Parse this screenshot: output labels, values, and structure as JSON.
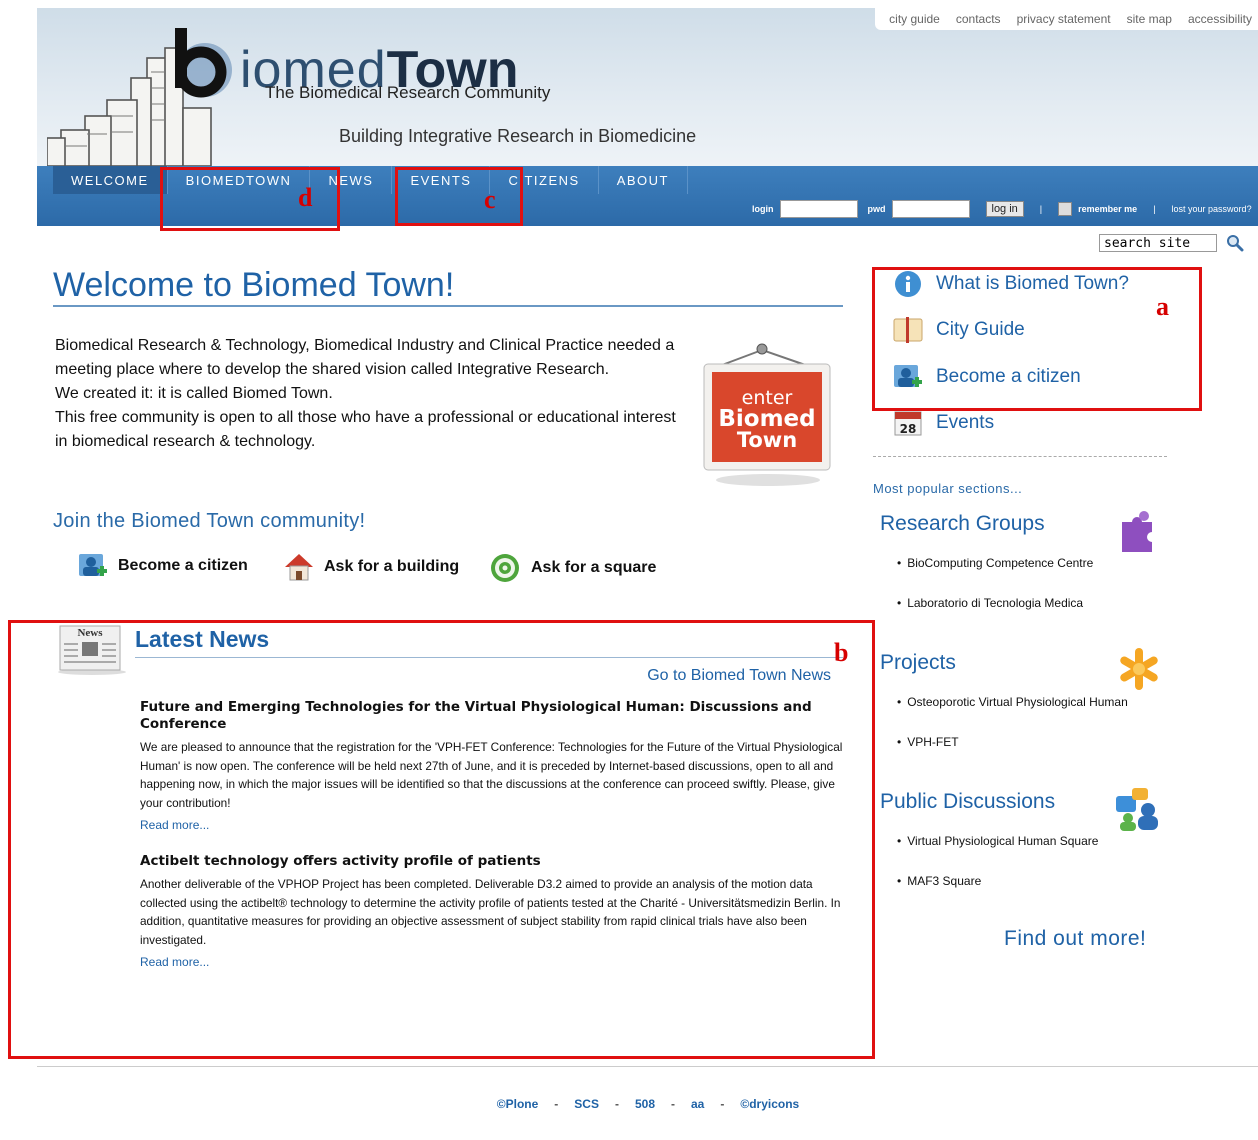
{
  "header": {
    "top_links": [
      "city guide",
      "contacts",
      "privacy statement",
      "site map",
      "accessibility"
    ],
    "logo_light": "iomed",
    "logo_bold": "Town",
    "tagline": "The Biomedical Research Community",
    "subtagline": "Building Integrative Research in Biomedicine"
  },
  "nav": {
    "tabs": [
      "WELCOME",
      "BIOMEDTOWN",
      "NEWS",
      "EVENTS",
      "CITIZENS",
      "ABOUT"
    ],
    "active_tab": "WELCOME"
  },
  "login": {
    "login_label": "login",
    "pwd_label": "pwd",
    "button": "log in",
    "remember": "remember me",
    "lost": "lost your password?"
  },
  "search": {
    "value": "search site"
  },
  "main": {
    "title": "Welcome to Biomed Town!",
    "intro": [
      "Biomedical Research & Technology, Biomedical Industry and Clinical Practice needed a meeting place where to develop the shared vision called Integrative Research.",
      "We created it: it is called Biomed Town.",
      "This free community is open to all those who have a professional or educational interest in biomedical research & technology."
    ],
    "sign": {
      "line1": "enter",
      "line2": "Biomed",
      "line3": "Town"
    },
    "join_title": "Join the Biomed Town community!",
    "join_items": [
      "Become a citizen",
      "Ask for a building",
      "Ask for a square"
    ]
  },
  "news": {
    "icon_label": "News",
    "title": "Latest News",
    "go_link": "Go to Biomed Town News",
    "articles": [
      {
        "title": "Future and Emerging Technologies for the Virtual Physiological Human: Discussions and Conference",
        "body": "We are pleased to announce that the registration for the 'VPH-FET Conference: Technologies for the Future of the Virtual Physiological Human' is now open. The conference will be held next 27th of June, and it is preceded by Internet-based discussions, open to all and happening now, in which the major issues will be identified so that the discussions at the conference can proceed swiftly. Please, give your contribution!",
        "more": "Read more..."
      },
      {
        "title": "Actibelt technology offers activity profile of patients",
        "body": "Another deliverable of the VPHOP Project has been completed. Deliverable D3.2 aimed to provide an analysis of the motion data collected using the actibelt® technology to determine the activity profile of patients tested at the Charité - Universitätsmedizin Berlin. In addition, quantitative measures for providing an objective assessment of subject stability from rapid clinical trials have also been investigated.",
        "more": "Read more..."
      }
    ]
  },
  "sidebar": {
    "links": [
      "What is Biomed Town?",
      "City Guide",
      "Become a citizen",
      "Events"
    ],
    "calendar_day": "28",
    "popular": "Most popular sections...",
    "sections": [
      {
        "title": "Research Groups",
        "items": [
          "BioComputing Competence Centre",
          "Laboratorio di Tecnologia Medica"
        ]
      },
      {
        "title": "Projects",
        "items": [
          "Osteoporotic Virtual Physiological Human",
          "VPH-FET"
        ]
      },
      {
        "title": "Public Discussions",
        "items": [
          "Virtual Physiological Human Square",
          "MAF3 Square"
        ]
      }
    ],
    "find_more": "Find out more!"
  },
  "footer": {
    "links": [
      "©Plone",
      "SCS",
      "508",
      "aa",
      "©dryicons"
    ]
  },
  "annotations": {
    "a": "a",
    "b": "b",
    "c": "c",
    "d": "d"
  },
  "colors": {
    "nav_blue": "#3474b2",
    "link_blue": "#1f62a6",
    "annotation_red": "#e01010"
  }
}
